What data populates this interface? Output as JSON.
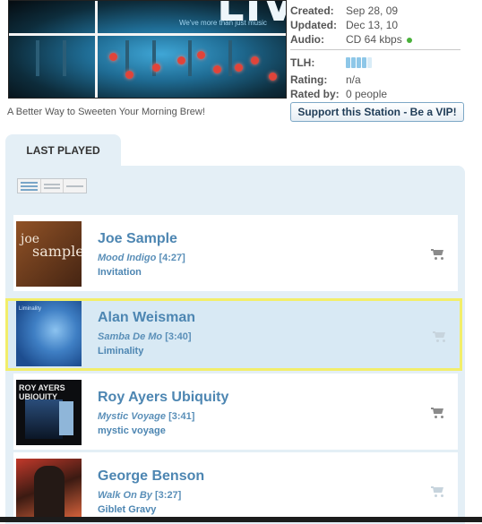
{
  "station": {
    "banner_text": "LIVE!",
    "banner_tag": "We've more than just music",
    "tagline": "A Better Way to Sweeten Your Morning Brew!",
    "created_label": "Created:",
    "created_value": "Sep 28, 09",
    "updated_label": "Updated:",
    "updated_value": "Dec 13, 10",
    "audio_label": "Audio:",
    "audio_value": "CD 64 kbps",
    "audio_status_color": "#4ab13b",
    "tlh_label": "TLH:",
    "tlh_level": 0.8,
    "rating_label": "Rating:",
    "rating_value": "n/a",
    "rated_by_label": "Rated by:",
    "rated_by_value": "0 people",
    "vip_button": "Support this Station - Be a VIP!"
  },
  "tabs": {
    "last_played": "LAST PLAYED"
  },
  "tracks": [
    {
      "artist": "Joe Sample",
      "title": "Mood Indigo",
      "duration": "[4:27]",
      "album": "Invitation",
      "cover_text_1": "joe",
      "cover_text_2": "sample"
    },
    {
      "artist": "Alan Weisman",
      "title": "Samba De Mo",
      "duration": "[3:40]",
      "album": "Liminality",
      "cover_text": "Liminality"
    },
    {
      "artist": "Roy Ayers Ubiquity",
      "title": "Mystic Voyage",
      "duration": "[3:41]",
      "album": "mystic voyage",
      "cover_text": "ROY AYERS UBIQUITY"
    },
    {
      "artist": "George Benson",
      "title": "Walk On By",
      "duration": "[3:27]",
      "album": "Giblet Gravy"
    }
  ],
  "colors": {
    "accent": "#4d86b2",
    "panel": "#e4eff6",
    "highlight_border": "#f2ee6a"
  }
}
